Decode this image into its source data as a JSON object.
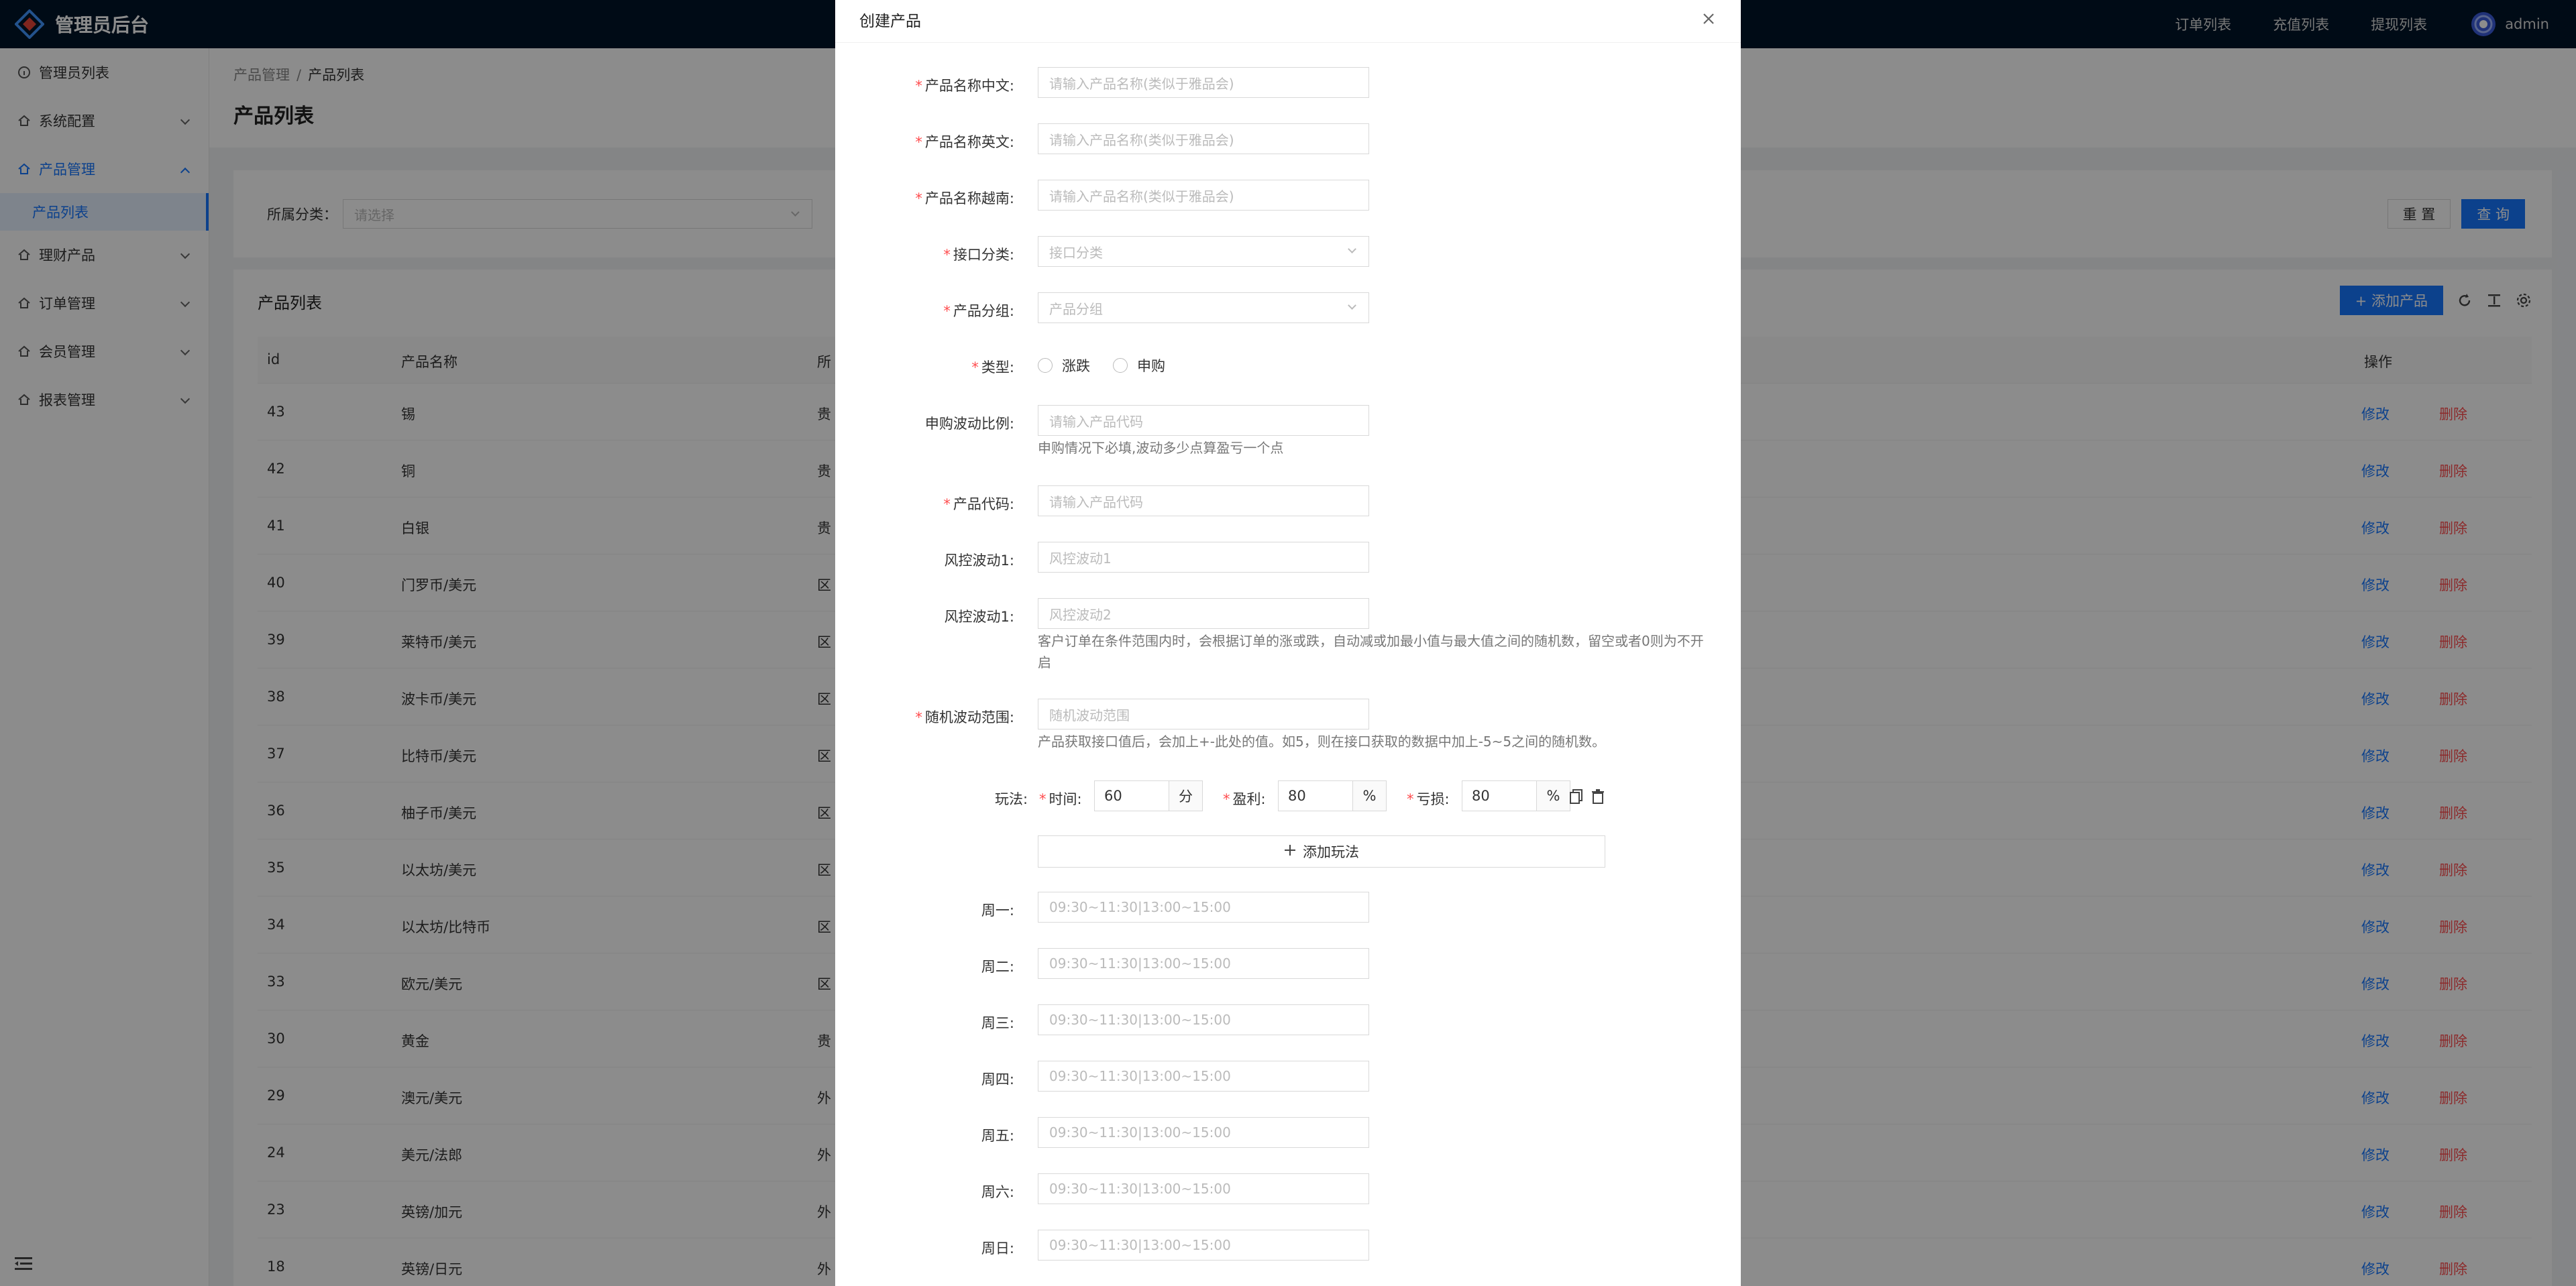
{
  "header": {
    "title": "管理员后台",
    "nav": [
      "订单列表",
      "充值列表",
      "提现列表"
    ],
    "user": "admin"
  },
  "sidebar": {
    "items": [
      {
        "label": "管理员列表"
      },
      {
        "label": "系统配置"
      },
      {
        "label": "产品管理"
      },
      {
        "label": "产品列表"
      },
      {
        "label": "理财产品"
      },
      {
        "label": "订单管理"
      },
      {
        "label": "会员管理"
      },
      {
        "label": "报表管理"
      }
    ]
  },
  "page": {
    "breadcrumb": [
      "产品管理",
      "/",
      "产品列表"
    ],
    "title": "产品列表",
    "filter": {
      "label": "所属分类：",
      "placeholder": "请选择",
      "reset": "重 置",
      "search": "查 询"
    },
    "table": {
      "title": "产品列表",
      "add_button": "+ 添加产品",
      "columns": [
        "id",
        "产品名称",
        "所",
        "操作"
      ],
      "rows": [
        {
          "id": "43",
          "name": "锡",
          "cat": "贵"
        },
        {
          "id": "42",
          "name": "铜",
          "cat": "贵"
        },
        {
          "id": "41",
          "name": "白银",
          "cat": "贵"
        },
        {
          "id": "40",
          "name": "门罗币/美元",
          "cat": "区"
        },
        {
          "id": "39",
          "name": "莱特币/美元",
          "cat": "区"
        },
        {
          "id": "38",
          "name": "波卡币/美元",
          "cat": "区"
        },
        {
          "id": "37",
          "name": "比特币/美元",
          "cat": "区"
        },
        {
          "id": "36",
          "name": "柚子币/美元",
          "cat": "区"
        },
        {
          "id": "35",
          "name": "以太坊/美元",
          "cat": "区"
        },
        {
          "id": "34",
          "name": "以太坊/比特币",
          "cat": "区"
        },
        {
          "id": "33",
          "name": "欧元/美元",
          "cat": "区"
        },
        {
          "id": "30",
          "name": "黄金",
          "cat": "贵"
        },
        {
          "id": "29",
          "name": "澳元/美元",
          "cat": "外"
        },
        {
          "id": "24",
          "name": "美元/法郎",
          "cat": "外"
        },
        {
          "id": "23",
          "name": "英镑/加元",
          "cat": "外"
        },
        {
          "id": "18",
          "name": "英镑/日元",
          "cat": "外"
        }
      ],
      "edit": "修改",
      "delete": "删除"
    }
  },
  "modal": {
    "title": "创建产品",
    "fields": {
      "name_cn": {
        "label": "产品名称中文:",
        "placeholder": "请输入产品名称(类似于雅品会)"
      },
      "name_en": {
        "label": "产品名称英文:",
        "placeholder": "请输入产品名称(类似于雅品会)"
      },
      "name_vn": {
        "label": "产品名称越南:",
        "placeholder": "请输入产品名称(类似于雅品会)"
      },
      "api_category": {
        "label": "接口分类:",
        "placeholder": "接口分类"
      },
      "group": {
        "label": "产品分组:",
        "placeholder": "产品分组"
      },
      "type": {
        "label": "类型:",
        "options": [
          "涨跌",
          "申购"
        ]
      },
      "sub_ratio": {
        "label": "申购波动比例:",
        "placeholder": "请输入产品代码",
        "help": "申购情况下必填,波动多少点算盈亏一个点"
      },
      "code": {
        "label": "产品代码:",
        "placeholder": "请输入产品代码"
      },
      "risk1": {
        "label": "风控波动1:",
        "placeholder": "风控波动1"
      },
      "risk2": {
        "label": "风控波动1:",
        "placeholder": "风控波动2",
        "help": "客户订单在条件范围内时，会根据订单的涨或跌，自动减或加最小值与最大值之间的随机数，留空或者0则为不开启"
      },
      "random": {
        "label": "随机波动范围:",
        "placeholder": "随机波动范围",
        "help": "产品获取接口值后，会加上+-此处的值。如5，则在接口获取的数据中加上-5~5之间的随机数。"
      }
    },
    "play": {
      "label": "玩法:",
      "time_label": "时间:",
      "time_value": "60",
      "time_unit": "分",
      "profit_label": "盈利:",
      "profit_value": "80",
      "profit_unit": "%",
      "loss_label": "亏损:",
      "loss_value": "80",
      "loss_unit": "%",
      "add_label": "添加玩法"
    },
    "weekdays": {
      "placeholder": "09:30~11:30|13:00~15:00",
      "labels": [
        "周一:",
        "周二:",
        "周三:",
        "周四:",
        "周五:",
        "周六:",
        "周日:"
      ]
    }
  }
}
